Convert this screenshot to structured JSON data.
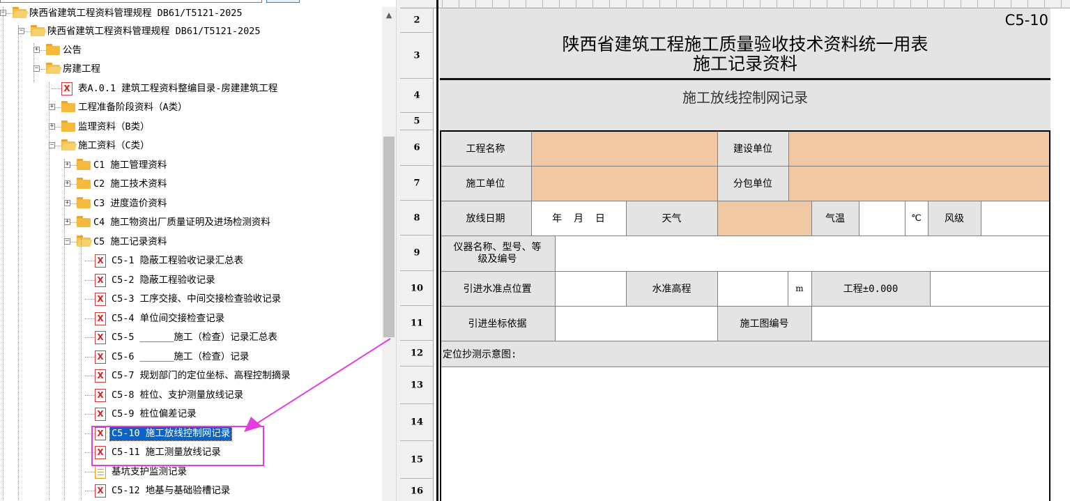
{
  "tree": {
    "items": [
      {
        "label": "陕西省建筑工程资料管理规程 DB61/T5121-2025",
        "type": "folder",
        "open": true,
        "expander": "−"
      },
      {
        "label": "陕西省建筑工程资料管理规程 DB61/T5121-2025",
        "type": "folder",
        "open": true,
        "expander": "−"
      },
      {
        "label": "公告",
        "type": "folder",
        "open": false,
        "expander": "+"
      },
      {
        "label": "房建工程",
        "type": "folder",
        "open": true,
        "expander": "−"
      },
      {
        "label": "表A.0.1 建筑工程资料整编目录-房建建筑工程",
        "type": "excel"
      },
      {
        "label": "工程准备阶段资料（A类）",
        "type": "folder",
        "open": false,
        "expander": "+"
      },
      {
        "label": "监理资料（B类）",
        "type": "folder",
        "open": false,
        "expander": "+"
      },
      {
        "label": "施工资料（C类）",
        "type": "folder",
        "open": true,
        "expander": "−"
      },
      {
        "label": "C1 施工管理资料",
        "type": "folder",
        "open": false,
        "expander": "+"
      },
      {
        "label": "C2 施工技术资料",
        "type": "folder",
        "open": false,
        "expander": "+"
      },
      {
        "label": "C3 进度造价资料",
        "type": "folder",
        "open": false,
        "expander": "+"
      },
      {
        "label": "C4 施工物资出厂质量证明及进场检测资料",
        "type": "folder",
        "open": false,
        "expander": "+"
      },
      {
        "label": "C5 施工记录资料",
        "type": "folder",
        "open": true,
        "expander": "−"
      },
      {
        "label": "C5-1 隐蔽工程验收记录汇总表",
        "type": "excel"
      },
      {
        "label": "C5-2 隐蔽工程验收记录",
        "type": "excel"
      },
      {
        "label": "C5-3 工序交接、中间交接检查验收记录",
        "type": "excel"
      },
      {
        "label": "C5-4 单位间交接检查记录",
        "type": "excel"
      },
      {
        "label": "C5-5 ______施工（检查）记录汇总表",
        "type": "excel"
      },
      {
        "label": "C5-6 ______施工（检查）记录",
        "type": "excel"
      },
      {
        "label": "C5-7 规划部门的定位坐标、高程控制摘录",
        "type": "excel"
      },
      {
        "label": "C5-8 桩位、支护测量放线记录",
        "type": "excel"
      },
      {
        "label": "C5-9 桩位偏差记录",
        "type": "excel"
      },
      {
        "label": "C5-10 施工放线控制网记录",
        "type": "excel",
        "selected": true
      },
      {
        "label": "C5-11 施工测量放线记录",
        "type": "excel"
      },
      {
        "label": "基坑支护监测记录",
        "type": "doc"
      },
      {
        "label": "C5-12 地基与基础验槽记录",
        "type": "excel"
      }
    ],
    "excel_glyph": "X"
  },
  "sheet": {
    "row_numbers": [
      "2",
      "3",
      "4",
      "5",
      "6",
      "7",
      "8",
      "9",
      "10",
      "11",
      "12",
      "13",
      "14",
      "15",
      "16"
    ],
    "form_code": "C5-10",
    "title_line1": "陕西省建筑工程施工质量验收技术资料统一用表",
    "title_line2": "施工记录资料",
    "subtitle": "施工放线控制网记录",
    "labels": {
      "project_name": "工程名称",
      "construction_unit": "建设单位",
      "builder_unit": "施工单位",
      "subcontract_unit": "分包单位",
      "date": "放线日期",
      "date_value": "年  月  日",
      "weather": "天气",
      "temperature": "气温",
      "celsius": "℃",
      "wind": "风级",
      "instrument": "仪器名称、型号、等级及编号",
      "benchmark_position": "引进水准点位置",
      "benchmark_elevation": "水准高程",
      "meter": "m",
      "project_zero": "工程±0.000",
      "coordinate_basis": "引进坐标依据",
      "drawing_number": "施工图编号",
      "sketch": "定位抄测示意图:"
    }
  },
  "colors": {
    "selection": "#0a64c8",
    "highlight": "#e33ee0",
    "input_fill": "#f0c9a4",
    "label_fill": "#e4e4e4"
  }
}
